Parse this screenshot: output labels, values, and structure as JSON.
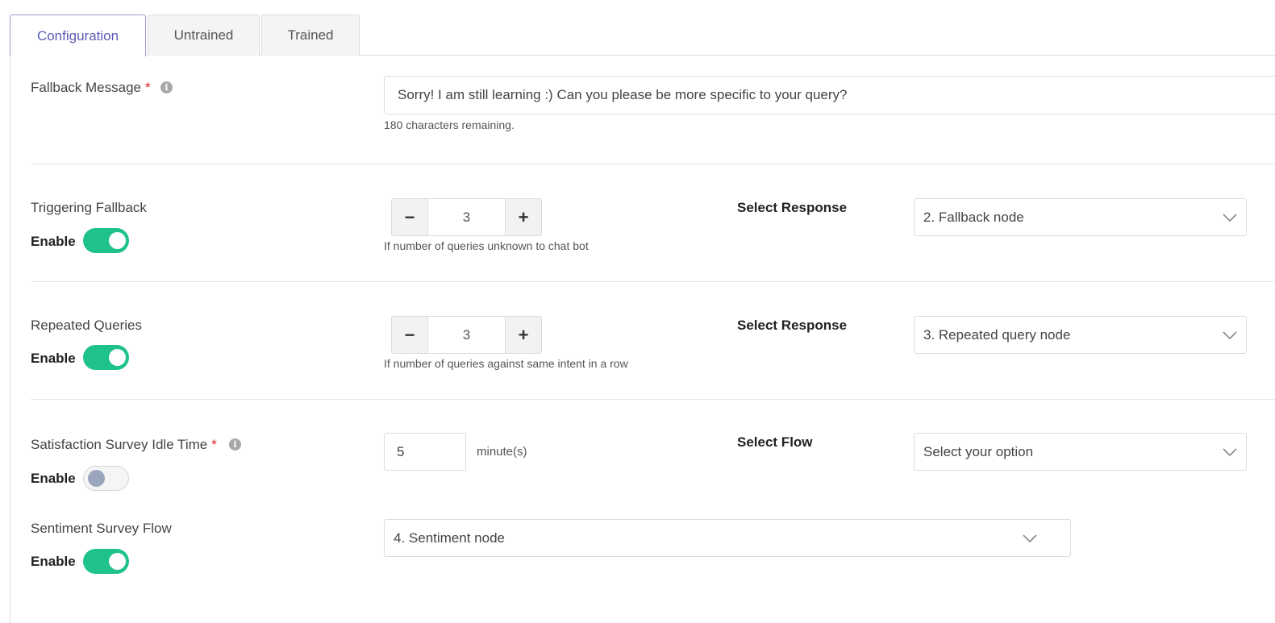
{
  "tabs": [
    {
      "label": "Configuration",
      "active": true
    },
    {
      "label": "Untrained",
      "active": false
    },
    {
      "label": "Trained",
      "active": false
    }
  ],
  "fallback_message": {
    "label": "Fallback Message",
    "required_mark": "*",
    "value": "Sorry! I am still learning :) Can you please be more specific to your query?",
    "remaining": "180 characters remaining."
  },
  "triggering_fallback": {
    "label": "Triggering Fallback",
    "enable_label": "Enable",
    "enabled": true,
    "count": "3",
    "hint": "If number of queries unknown to chat bot",
    "select_label": "Select Response",
    "selected": "2. Fallback node"
  },
  "repeated_queries": {
    "label": "Repeated Queries",
    "enable_label": "Enable",
    "enabled": true,
    "count": "3",
    "hint": "If number of queries against same intent in a row",
    "select_label": "Select Response",
    "selected": "3. Repeated query node"
  },
  "satisfaction_survey": {
    "label": "Satisfaction Survey Idle Time",
    "required_mark": "*",
    "enable_label": "Enable",
    "enabled": false,
    "idle_value": "5",
    "unit": "minute(s)",
    "select_label": "Select Flow",
    "selected": "Select your option"
  },
  "sentiment_survey": {
    "label": "Sentiment Survey Flow",
    "enable_label": "Enable",
    "enabled": true,
    "selected": "4. Sentiment node"
  },
  "colors": {
    "accent": "#5b5bb5",
    "toggle_on": "#1fc28c",
    "required": "#e02020"
  }
}
